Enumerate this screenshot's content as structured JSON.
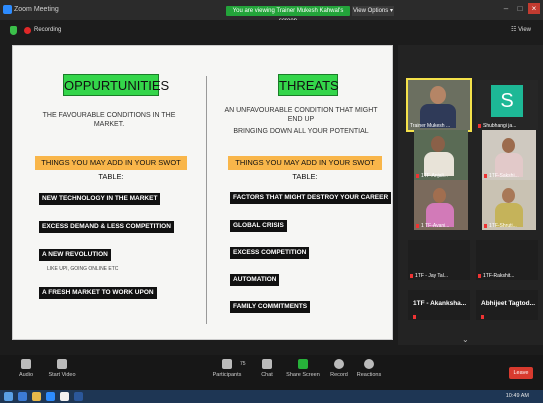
{
  "window": {
    "title": "Zoom Meeting",
    "viewing_banner": "You are viewing Trainer Mukesh Kahwal's screen",
    "view_options": "View Options ▾"
  },
  "top": {
    "recording": "Recording",
    "view": "View"
  },
  "slide": {
    "left": {
      "heading": "OPPURTUNITIES",
      "description": "THE FAVOURABLE CONDITIONS IN THE MARKET.",
      "banner": "THINGS YOU MAY ADD IN YOUR SWOT TABLE:",
      "items": [
        "NEW TECHNOLOGY IN THE MARKET",
        "EXCESS DEMAND & LESS COMPETITION",
        "A NEW REVOLUTION",
        "A FRESH MARKET TO WORK UPON"
      ],
      "note": "LIKE UPI, GOING ONLINE ETC"
    },
    "right": {
      "heading": "THREATS",
      "description_line1": "AN UNFAVOURABLE CONDITION THAT MIGHT END UP",
      "description_line2": "BRINGING DOWN ALL YOUR POTENTIAL",
      "banner": "THINGS YOU MAY ADD IN YOUR SWOT TABLE:",
      "items": [
        "FACTORS THAT MIGHT DESTROY YOUR CAREER",
        "GLOBAL CRISIS",
        "EXCESS COMPETITION",
        "AUTOMATION",
        "FAMILY COMMITMENTS"
      ]
    }
  },
  "participants": {
    "tiles": [
      {
        "name": "Trainer Mukesh ..."
      },
      {
        "name": "Shubhangi ja..."
      },
      {
        "name": "1TF-Anjali..."
      },
      {
        "name": "1TF-Sakshi..."
      },
      {
        "name": "1 TF-Avani..."
      },
      {
        "name": "1TF-Shruti..."
      },
      {
        "name": "1TF - Jay Tal..."
      },
      {
        "name": "1TF-Rakshit..."
      }
    ],
    "name_only": [
      {
        "name": "1TF - Akanksha..."
      },
      {
        "name": "Abhijeet Tagtod..."
      }
    ],
    "avatar_letter": "S",
    "more_chevron": "⌄"
  },
  "toolbar": {
    "audio": "Audio",
    "video": "Start Video",
    "participants": "Participants",
    "participants_count": "75",
    "chat": "Chat",
    "share": "Share Screen",
    "record": "Record",
    "reactions": "Reactions",
    "leave": "Leave"
  },
  "taskbar": {
    "time": "10:49 AM"
  }
}
